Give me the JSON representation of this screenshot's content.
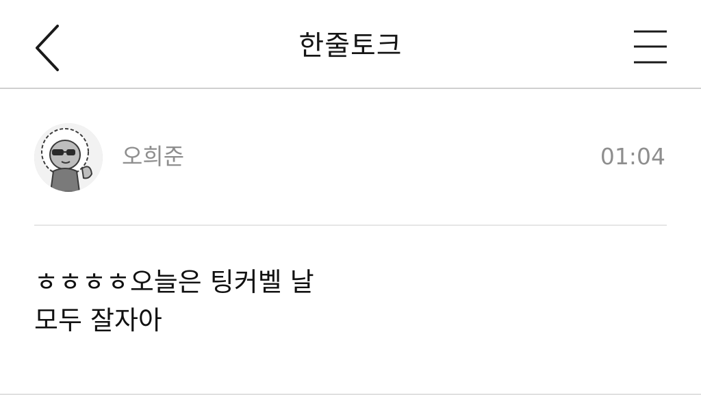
{
  "header": {
    "title": "한줄토크",
    "back_icon": "chevron-left-icon",
    "menu_icon": "hamburger-menu-icon"
  },
  "post": {
    "author": "오희준",
    "time": "01:04",
    "avatar_icon": "character-avatar-icon",
    "message_lines": [
      "ㅎㅎㅎㅎ오늘은 팅커벨 날",
      "모두 잘자아"
    ]
  }
}
